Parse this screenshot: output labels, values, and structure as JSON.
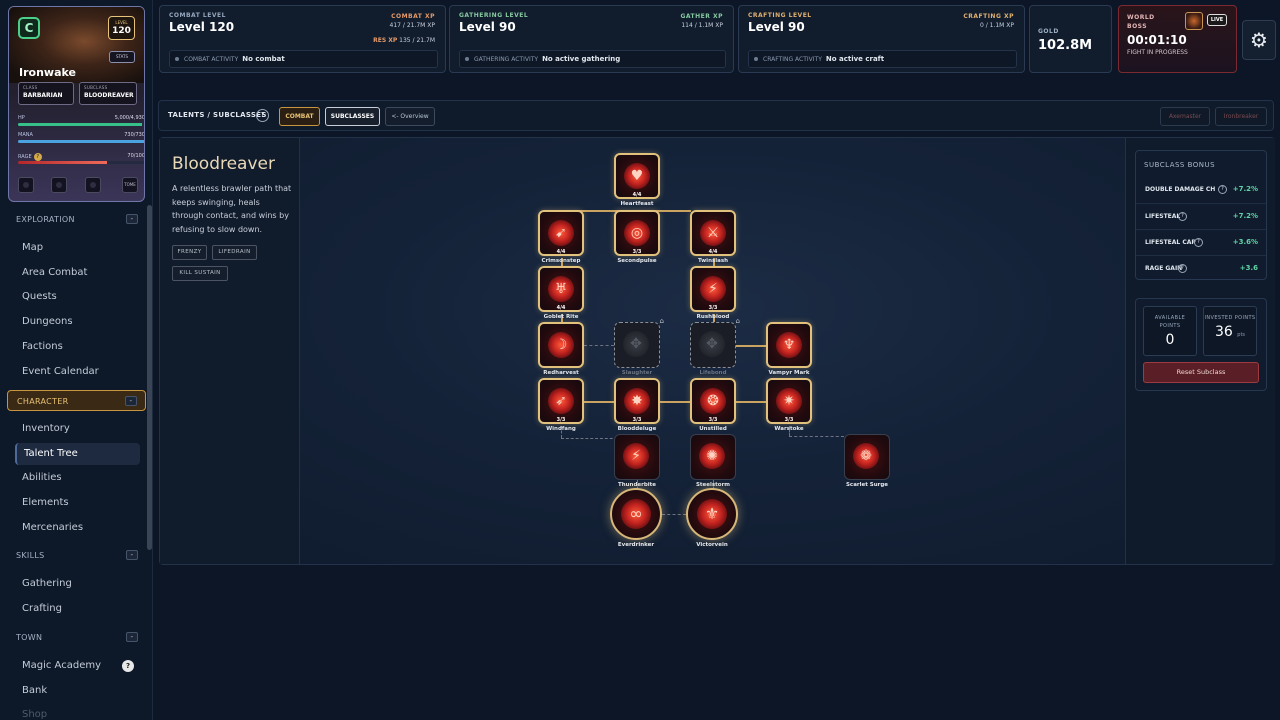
{
  "character": {
    "initial": "C",
    "level_label": "LEVEL",
    "level": "120",
    "name": "Ironwake",
    "stats_label": "STATS",
    "class_label": "CLASS",
    "class_value": "BARBARIAN",
    "subclass_label": "SUBCLASS",
    "subclass_value": "BLOODREAVER",
    "hp_label": "HP",
    "hp_value": "5,000/4,930",
    "hp_fraction": 0.98,
    "mana_label": "MANA",
    "mana_value": "730/730",
    "mana_fraction": 1.0,
    "rage_label": "RAGE",
    "rage_value": "70/100",
    "rage_fraction": 0.7,
    "tome_label": "TOME"
  },
  "nav": {
    "exploration": {
      "label": "EXPLORATION",
      "toggle": "-",
      "items": [
        "Map",
        "Area Combat",
        "Quests",
        "Dungeons",
        "Factions",
        "Event Calendar"
      ]
    },
    "character": {
      "label": "CHARACTER",
      "toggle": "-",
      "items": [
        "Inventory",
        "Talent Tree",
        "Abilities",
        "Elements",
        "Mercenaries"
      ]
    },
    "skills": {
      "label": "SKILLS",
      "toggle": "-",
      "items": [
        "Gathering",
        "Crafting"
      ]
    },
    "town": {
      "label": "TOWN",
      "toggle": "-",
      "items": [
        "Magic Academy",
        "Bank",
        "Shop"
      ],
      "magic_badge": "?"
    }
  },
  "topbar": {
    "combat": {
      "heading": "COMBAT LEVEL",
      "level": "Level 120",
      "xp_label": "COMBAT XP",
      "xp_value": "417 / 21.7M XP",
      "res_label": "RES XP",
      "res_value": "135 / 21.7M",
      "activity_label": "COMBAT ACTIVITY",
      "activity_value": "No combat",
      "color": "#e39a6a"
    },
    "gathering": {
      "heading": "GATHERING LEVEL",
      "level": "Level 90",
      "xp_label": "GATHER XP",
      "xp_value": "114 / 1.1M XP",
      "activity_label": "GATHERING ACTIVITY",
      "activity_value": "No active gathering",
      "color": "#86c9a0"
    },
    "crafting": {
      "heading": "CRAFTING LEVEL",
      "level": "Level 90",
      "xp_label": "CRAFTING XP",
      "xp_value": "0 / 1.1M XP",
      "activity_label": "CRAFTING ACTIVITY",
      "activity_value": "No active craft",
      "color": "#e0b070"
    },
    "gold": {
      "label": "GOLD",
      "value": "102.8M"
    },
    "boss": {
      "label": "WORLD BOSS",
      "timer": "00:01:10",
      "status": "FIGHT IN PROGRESS",
      "live": "LIVE"
    },
    "settings_icon": "gear-icon"
  },
  "tabs": {
    "title": "TALENTS / SUBCLASSES",
    "help": "?",
    "combat": "COMBAT",
    "subclasses": "SUBCLASSES",
    "overview": "<- Overview",
    "axemaster": "Axemaster",
    "ironbreaker": "Ironbreaker"
  },
  "subclass": {
    "name": "Bloodreaver",
    "description": "A relentless brawler path that keeps swinging, heals through contact, and wins by refusing to slow down.",
    "tags": [
      "FRENZY",
      "LIFEDRAIN",
      "KILL SUSTAIN"
    ]
  },
  "talents": [
    {
      "name": "Heartfeast",
      "rank": "4/4",
      "glyph": "♥"
    },
    {
      "name": "Crimsonstep",
      "rank": "4/4",
      "glyph": "➹"
    },
    {
      "name": "Secondpulse",
      "rank": "3/3",
      "glyph": "◎"
    },
    {
      "name": "Twinslash",
      "rank": "4/4",
      "glyph": "⚔"
    },
    {
      "name": "Goblet Rite",
      "rank": "4/4",
      "glyph": "♅"
    },
    {
      "name": "Rushblood",
      "rank": "3/3",
      "glyph": "⚡"
    },
    {
      "name": "Redharvest",
      "rank": "",
      "glyph": "☽"
    },
    {
      "name": "Slaughter",
      "rank": "",
      "glyph": "✥"
    },
    {
      "name": "Lifebond",
      "rank": "",
      "glyph": "✥"
    },
    {
      "name": "Vampyr Mark",
      "rank": "",
      "glyph": "♆"
    },
    {
      "name": "Windfang",
      "rank": "3/3",
      "glyph": "➶"
    },
    {
      "name": "Blooddeluge",
      "rank": "3/3",
      "glyph": "✸"
    },
    {
      "name": "Unstilled",
      "rank": "3/3",
      "glyph": "❂"
    },
    {
      "name": "Warstoke",
      "rank": "3/3",
      "glyph": "✷"
    },
    {
      "name": "Thunderbite",
      "rank": "",
      "glyph": "⚡"
    },
    {
      "name": "Steelstorm",
      "rank": "",
      "glyph": "✺"
    },
    {
      "name": "Scarlet Surge",
      "rank": "",
      "glyph": "❁"
    },
    {
      "name": "Everdrinker",
      "rank": "",
      "glyph": "∞"
    },
    {
      "name": "Victorvein",
      "rank": "",
      "glyph": "⚜"
    }
  ],
  "bonus": {
    "title": "SUBCLASS BONUS",
    "rows": [
      {
        "name": "DOUBLE DAMAGE CHA...",
        "value": "+7.2%"
      },
      {
        "name": "LIFESTEAL",
        "value": "+7.2%"
      },
      {
        "name": "LIFESTEAL CAP",
        "value": "+3.6%"
      },
      {
        "name": "RAGE GAIN",
        "value": "+3.6"
      }
    ]
  },
  "points": {
    "available_label": "AVAILABLE POINTS",
    "available": "0",
    "invested_label": "INVESTED POINTS",
    "invested": "36",
    "invested_unit": "pts",
    "reset": "Reset Subclass"
  }
}
